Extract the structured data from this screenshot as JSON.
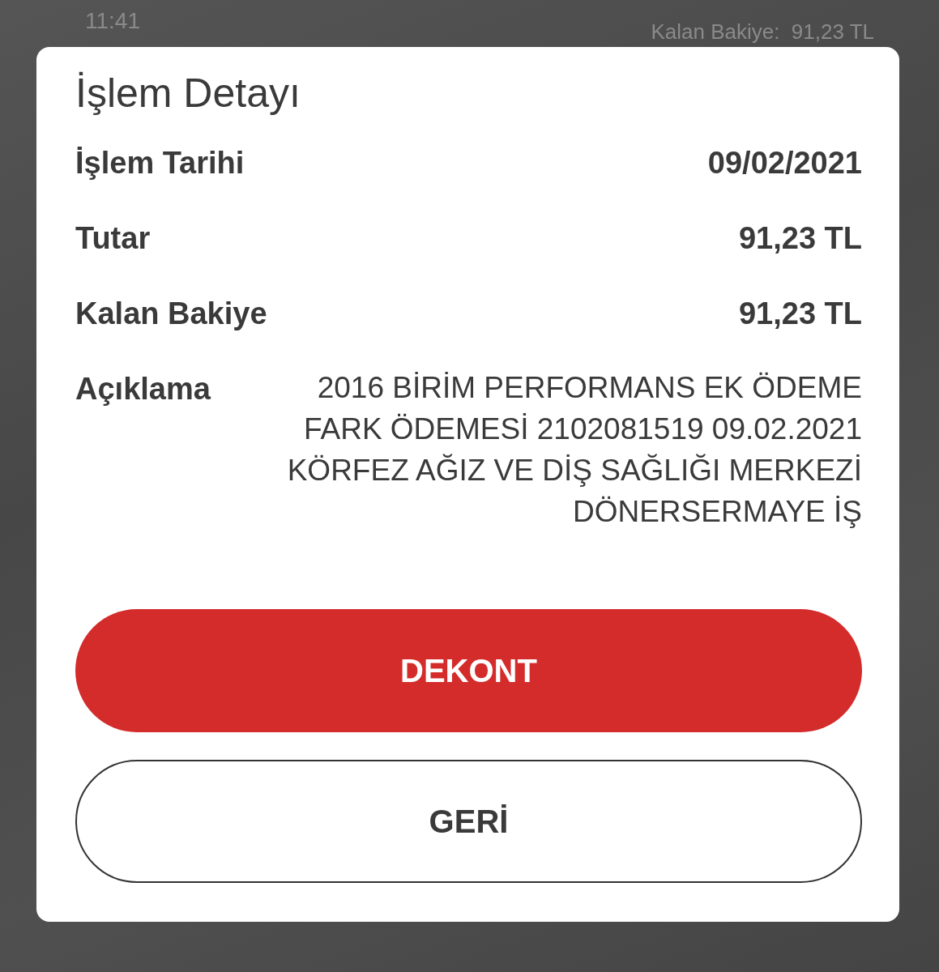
{
  "background": {
    "time": "11:41",
    "balance": "Kalan Bakiye:  91,23 TL"
  },
  "dialog": {
    "title": "İşlem Detayı",
    "rows": [
      {
        "label": "İşlem Tarihi",
        "value": "09/02/2021"
      },
      {
        "label": "Tutar",
        "value": "91,23 TL"
      },
      {
        "label": "Kalan Bakiye",
        "value": "91,23 TL"
      }
    ],
    "description": {
      "label": "Açıklama",
      "value": "2016 BİRİM PERFORMANS EK ÖDEME FARK ÖDEMESİ 2102081519 09.02.2021 KÖRFEZ AĞIZ VE DİŞ SAĞLIĞI MERKEZİ DÖNERSERMAYE İŞ"
    },
    "buttons": [
      {
        "label": "DEKONT",
        "kind": "primary"
      },
      {
        "label": "GERİ",
        "kind": "outline"
      }
    ]
  }
}
